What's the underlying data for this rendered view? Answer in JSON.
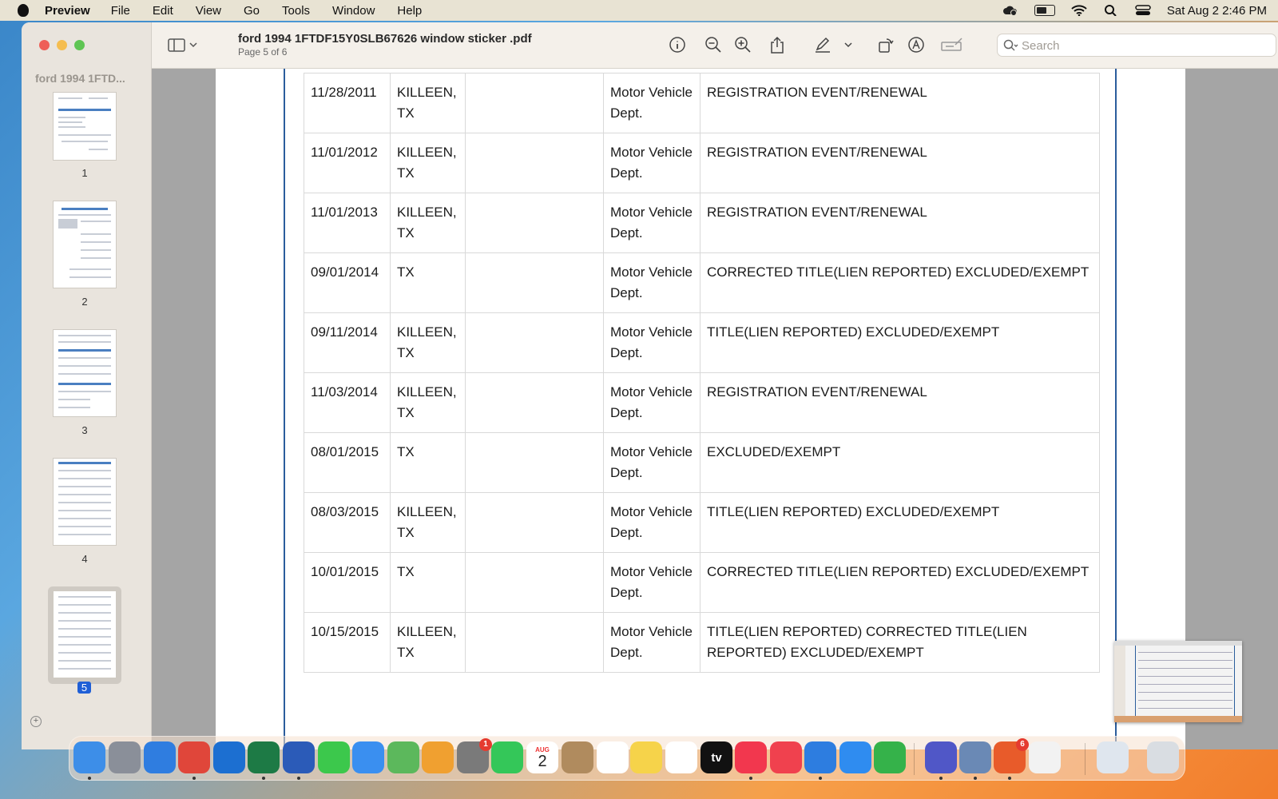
{
  "menubar": {
    "app": "Preview",
    "items": [
      "File",
      "Edit",
      "View",
      "Go",
      "Tools",
      "Window",
      "Help"
    ],
    "datetime": "Sat Aug 2  2:46 PM"
  },
  "sidebar": {
    "title": "ford 1994 1FTD...",
    "pages": [
      "1",
      "2",
      "3",
      "4",
      "5"
    ],
    "selected": "5"
  },
  "toolbar": {
    "doc_title": "ford 1994 1FTDF15Y0SLB67626 window sticker .pdf",
    "page_info": "Page 5 of 6",
    "search_placeholder": "Search"
  },
  "table": {
    "rows": [
      {
        "date": "11/28/2011",
        "location": "KILLEEN, TX",
        "source": "",
        "agency": "Motor Vehicle Dept.",
        "event": "REGISTRATION EVENT/RENEWAL"
      },
      {
        "date": "11/01/2012",
        "location": "KILLEEN, TX",
        "source": "",
        "agency": "Motor Vehicle Dept.",
        "event": "REGISTRATION EVENT/RENEWAL"
      },
      {
        "date": "11/01/2013",
        "location": "KILLEEN, TX",
        "source": "",
        "agency": "Motor Vehicle Dept.",
        "event": "REGISTRATION EVENT/RENEWAL"
      },
      {
        "date": "09/01/2014",
        "location": "TX",
        "source": "",
        "agency": "Motor Vehicle Dept.",
        "event": "CORRECTED TITLE(LIEN REPORTED) EXCLUDED/EXEMPT"
      },
      {
        "date": "09/11/2014",
        "location": "KILLEEN, TX",
        "source": "",
        "agency": "Motor Vehicle Dept.",
        "event": "TITLE(LIEN REPORTED) EXCLUDED/EXEMPT"
      },
      {
        "date": "11/03/2014",
        "location": "KILLEEN, TX",
        "source": "",
        "agency": "Motor Vehicle Dept.",
        "event": "REGISTRATION EVENT/RENEWAL"
      },
      {
        "date": "08/01/2015",
        "location": "TX",
        "source": "",
        "agency": "Motor Vehicle Dept.",
        "event": "EXCLUDED/EXEMPT"
      },
      {
        "date": "08/03/2015",
        "location": "KILLEEN, TX",
        "source": "",
        "agency": "Motor Vehicle Dept.",
        "event": "TITLE(LIEN REPORTED) EXCLUDED/EXEMPT"
      },
      {
        "date": "10/01/2015",
        "location": "TX",
        "source": "",
        "agency": "Motor Vehicle Dept.",
        "event": "CORRECTED TITLE(LIEN REPORTED) EXCLUDED/EXEMPT"
      },
      {
        "date": "10/15/2015",
        "location": "KILLEEN, TX",
        "source": "",
        "agency": "Motor Vehicle Dept.",
        "event": "TITLE(LIEN REPORTED) CORRECTED TITLE(LIEN REPORTED) EXCLUDED/EXEMPT"
      }
    ]
  },
  "dock": {
    "calendar_month": "AUG",
    "calendar_day": "2",
    "settings_badge": "1",
    "office_badge": "6",
    "tv_label": "tv",
    "apps": [
      {
        "name": "finder-icon",
        "color": "#3d8ee8"
      },
      {
        "name": "launchpad-icon",
        "color": "#8a8f99"
      },
      {
        "name": "safari-icon",
        "color": "#2f7de0"
      },
      {
        "name": "chrome-icon",
        "color": "#e0463a"
      },
      {
        "name": "onedrive-icon",
        "color": "#1c6fd1"
      },
      {
        "name": "excel-icon",
        "color": "#1d7a45"
      },
      {
        "name": "word-icon",
        "color": "#2b5bb8"
      },
      {
        "name": "messages-icon",
        "color": "#3cc84c"
      },
      {
        "name": "mail-icon",
        "color": "#3a8ff0"
      },
      {
        "name": "maps-icon",
        "color": "#5cb85c"
      },
      {
        "name": "photos-icon",
        "color": "#f0a030"
      },
      {
        "name": "system-settings-icon",
        "color": "#7a7a7a"
      },
      {
        "name": "facetime-icon",
        "color": "#34c759"
      },
      {
        "name": "calendar-icon",
        "color": "#ffffff"
      },
      {
        "name": "contacts-icon",
        "color": "#b08b5e"
      },
      {
        "name": "reminders-icon",
        "color": "#ffffff"
      },
      {
        "name": "notes-icon",
        "color": "#f6d34a"
      },
      {
        "name": "freeform-icon",
        "color": "#ffffff"
      },
      {
        "name": "apple-tv-icon",
        "color": "#111111"
      },
      {
        "name": "music-icon",
        "color": "#f2374e"
      },
      {
        "name": "news-icon",
        "color": "#f0414e"
      },
      {
        "name": "keynote-icon",
        "color": "#2d7de0"
      },
      {
        "name": "app-store-icon",
        "color": "#2f8cf0"
      },
      {
        "name": "numbers-icon",
        "color": "#35b24a"
      },
      {
        "name": "teams-icon",
        "color": "#5057c7"
      },
      {
        "name": "preview-icon",
        "color": "#6a89b5"
      },
      {
        "name": "office-icon",
        "color": "#e85b2a"
      },
      {
        "name": "textedit-icon",
        "color": "#f2f2f2"
      },
      {
        "name": "downloads-stack-icon",
        "color": "#dfe6ee"
      },
      {
        "name": "trash-icon",
        "color": "#d9dde2"
      }
    ]
  }
}
